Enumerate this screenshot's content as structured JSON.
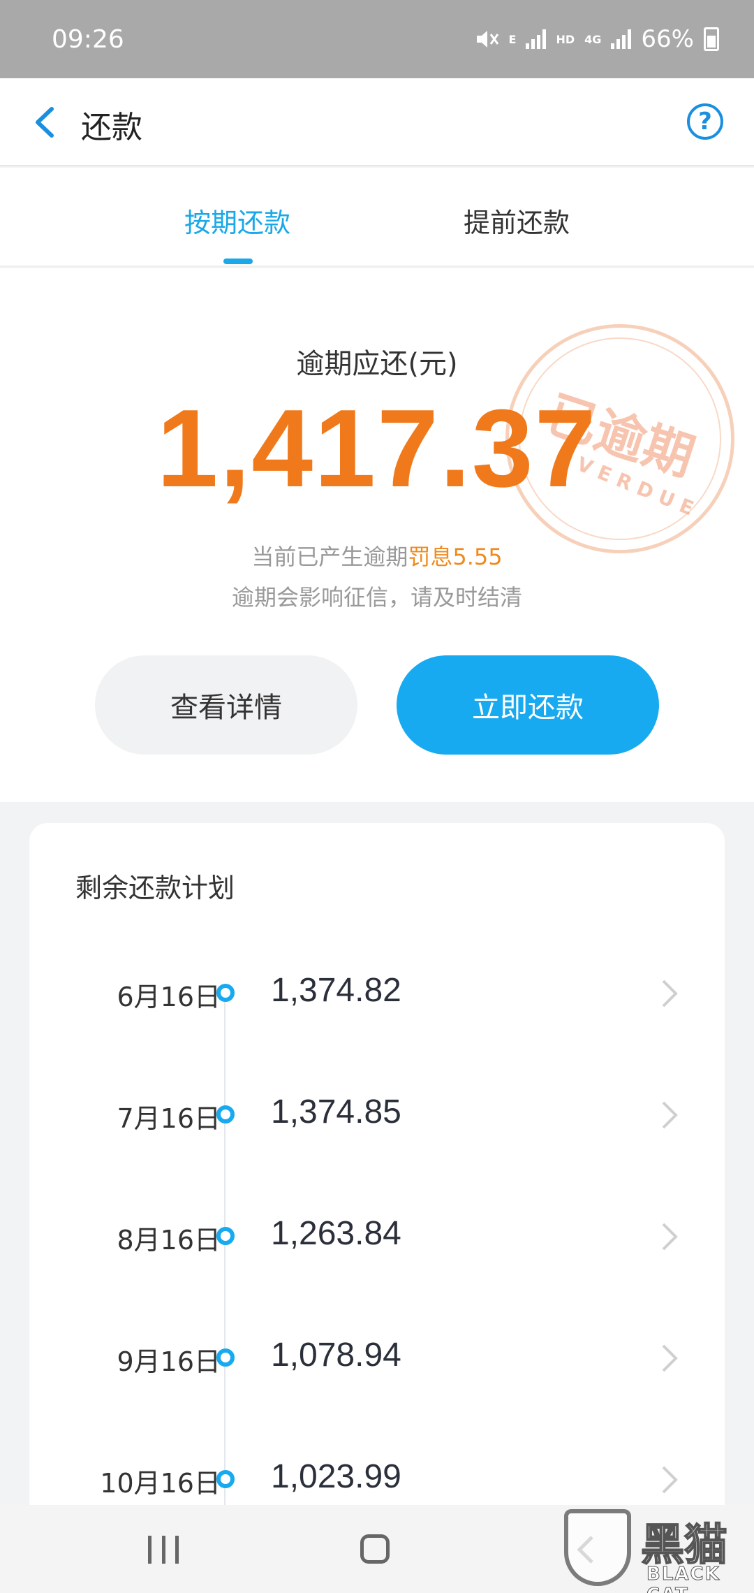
{
  "status_bar": {
    "time": "09:26",
    "network_e": "E",
    "network_hd": "HD",
    "network_4g": "4G",
    "battery": "66%"
  },
  "header": {
    "title": "还款",
    "help_symbol": "?"
  },
  "tabs": [
    {
      "label": "按期还款",
      "active": true
    },
    {
      "label": "提前还款",
      "active": false
    }
  ],
  "summary": {
    "label": "逾期应还(元)",
    "amount": "1,417.37",
    "notice_prefix": "当前已产生逾期",
    "penalty_text": "罚息5.55",
    "notice_line2": "逾期会影响征信，请及时结清",
    "stamp_cn": "已逾期",
    "stamp_en": "OVERDUE"
  },
  "actions": {
    "details_label": "查看详情",
    "pay_label": "立即还款"
  },
  "plan": {
    "title": "剩余还款计划",
    "items": [
      {
        "date": "6月16日",
        "amount": "1,374.82"
      },
      {
        "date": "7月16日",
        "amount": "1,374.85"
      },
      {
        "date": "8月16日",
        "amount": "1,263.84"
      },
      {
        "date": "9月16日",
        "amount": "1,078.94"
      },
      {
        "date": "10月16日",
        "amount": "1,023.99"
      }
    ]
  },
  "watermark": {
    "cn": "黑猫",
    "en": "BLACK CAT"
  },
  "colors": {
    "accent": "#18aaf0",
    "amount": "#f07a1b",
    "penalty": "#f08a1c",
    "status_bar": "#a9a9a9"
  },
  "icons": [
    "back-icon",
    "help-icon",
    "chevron-right-icon",
    "mute-icon",
    "signal-icon",
    "battery-icon",
    "nav-recents-icon",
    "nav-home-icon",
    "nav-back-icon"
  ]
}
